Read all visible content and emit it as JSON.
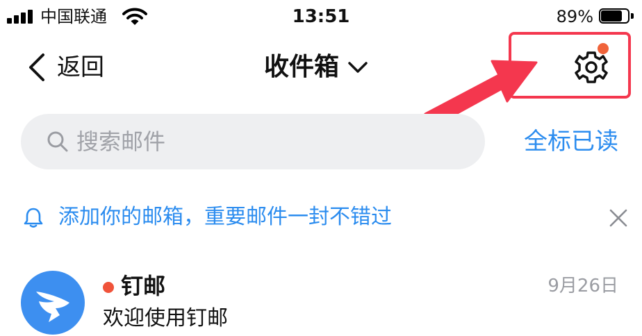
{
  "status_bar": {
    "carrier": "中国联通",
    "time": "13:51",
    "battery_percent": "89%",
    "battery_level": 0.89
  },
  "nav": {
    "back_label": "返回",
    "title": "收件箱",
    "icons": {
      "back": "chevron-left-icon",
      "title_dropdown": "chevron-down-icon",
      "settings": "gear-icon"
    }
  },
  "search": {
    "placeholder": "搜索邮件",
    "mark_all_read": "全标已读"
  },
  "notice": {
    "text": "添加你的邮箱，重要邮件一封不错过",
    "icons": {
      "bell": "bell-icon",
      "close": "close-icon"
    }
  },
  "mails": [
    {
      "sender": "钉邮",
      "subject": "欢迎使用钉邮",
      "date": "9月26日",
      "unread": true
    }
  ],
  "colors": {
    "accent": "#2b8cef",
    "highlight": "#f4374e",
    "badge": "#f0633a",
    "unread": "#f0533a",
    "avatar": "#3d8ff0",
    "search_bg": "#eeeff1",
    "muted": "#9a9ca2"
  }
}
